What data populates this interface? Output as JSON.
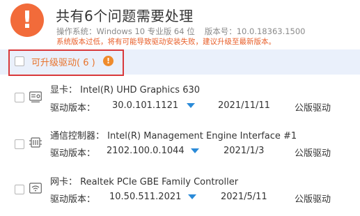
{
  "header": {
    "warn_icon": "!",
    "title": "共有6个问题需要处理",
    "os_label": "操作系统：Windows 10 专业版 64 位",
    "version_label": "版本号：10.0.18363.1500",
    "notice": "系统版本过低，将有可能导致驱动安装失败，建议升级至最新版本。",
    "accent_color": "#f26b3a"
  },
  "group": {
    "label": "可升级驱动",
    "count_text": "( 6 )",
    "info_icon": "!"
  },
  "devices": [
    {
      "name": "显卡： Intel(R) UHD Graphics 630",
      "icon": "display-icon",
      "version_label": "驱动版本：",
      "version": "30.0.101.1121",
      "date": "2021/11/11",
      "type": "公版驱动"
    },
    {
      "name": "通信控制器： Intel(R) Management Engine Interface #1",
      "icon": "chip-icon",
      "version_label": "驱动版本：",
      "version": "2102.100.0.1044",
      "date": "2021/1/3",
      "type": "公版驱动"
    },
    {
      "name": "网卡： Realtek PCIe GBE Family Controller",
      "icon": "wifi-icon",
      "version_label": "驱动版本：",
      "version": "10.50.511.2021",
      "date": "2021/5/11",
      "type": "公版驱动"
    }
  ]
}
